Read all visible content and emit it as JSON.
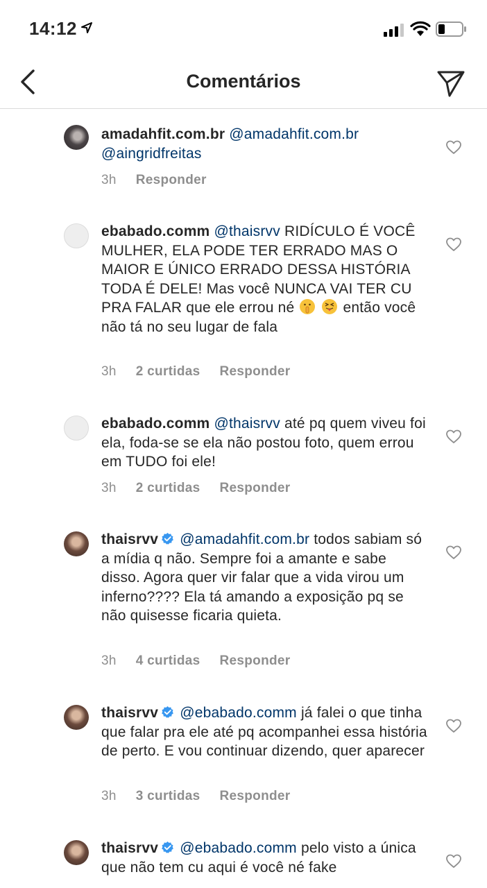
{
  "status_bar": {
    "time": "14:12",
    "icons": [
      "location-arrow-icon",
      "cellular-signal-icon",
      "wifi-icon",
      "battery-low-icon"
    ]
  },
  "nav": {
    "title": "Comentários",
    "icons": [
      "chevron-left-icon",
      "send-direct-icon"
    ]
  },
  "colors": {
    "text": "#262626",
    "mention": "#003569",
    "meta": "#8e8e8e",
    "verified": "#3897f0",
    "divider": "#dbdbdb"
  },
  "comments": [
    {
      "username": "amadahfit.com.br",
      "verified": false,
      "mention": "@amadahfit.com.br",
      "lines": [
        "@aingridfreitas"
      ],
      "time": "3h",
      "likes": "",
      "reply": "Responder"
    },
    {
      "username": "ebabado.comm",
      "verified": false,
      "mention": "@thaisrvv",
      "text_1": "RIDÍCULO É VOCÊ MULHER, ELA PODE TER ERRADO MAS O MAIOR E ÚNICO ERRADO DESSA HISTÓRIA TODA É DELE!  Mas você NUNCA VAI TER CU PRA FALAR que ele errou né",
      "emojis": [
        "shushing-face-emoji",
        "squinting-tongue-emoji"
      ],
      "text_2": "então você não tá no seu lugar de fala",
      "time": "3h",
      "likes": "2 curtidas",
      "reply": "Responder"
    },
    {
      "username": "ebabado.comm",
      "verified": false,
      "mention": "@thaisrvv",
      "text": "até pq quem viveu foi ela, foda-se se ela não postou foto, quem errou em TUDO foi ele!",
      "time": "3h",
      "likes": "2 curtidas",
      "reply": "Responder"
    },
    {
      "username": "thaisrvv",
      "verified": true,
      "mention": "@amadahfit.com.br",
      "text": "todos sabiam só a mídia q não. Sempre foi a amante e sabe disso. Agora quer vir falar que a vida virou um inferno???? Ela tá amando a exposição pq se não quisesse ficaria quieta.",
      "time": "3h",
      "likes": "4 curtidas",
      "reply": "Responder"
    },
    {
      "username": "thaisrvv",
      "verified": true,
      "mention": "@ebabado.comm",
      "text": "já falei o que tinha que falar pra ele até pq acompanhei essa história de perto. E vou continuar dizendo, quer aparecer",
      "time": "3h",
      "likes": "3 curtidas",
      "reply": "Responder"
    },
    {
      "username": "thaisrvv",
      "verified": true,
      "mention": "@ebabado.comm",
      "text": "pelo visto a única que não tem cu aqui é você né fake"
    }
  ]
}
